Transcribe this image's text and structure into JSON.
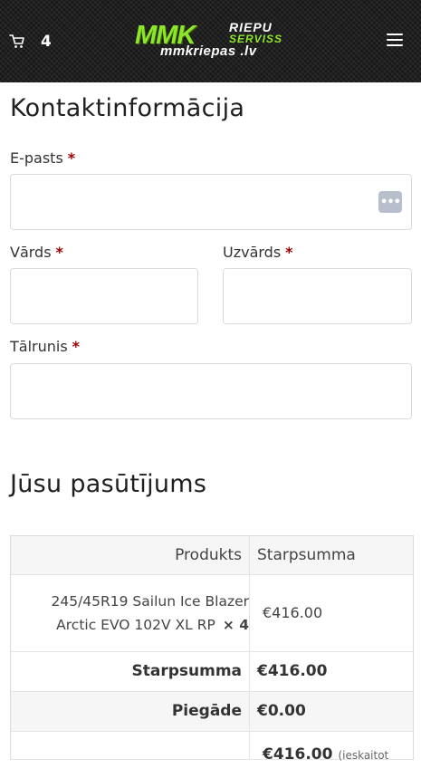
{
  "header": {
    "cart_count": "4",
    "logo": {
      "brand": "MMK",
      "line1": "RIEPU",
      "line2": "SERVISS",
      "url": "mmkriepas .lv"
    }
  },
  "contact": {
    "title": "Kontaktinformācija",
    "email_label": "E-pasts",
    "first_name_label": "Vārds",
    "last_name_label": "Uzvārds",
    "phone_label": "Tālrunis",
    "required_mark": "*",
    "email_value": "",
    "first_name_value": "",
    "last_name_value": "",
    "phone_value": ""
  },
  "order": {
    "title": "Jūsu pasūtījums",
    "col_product": "Produkts",
    "col_subtotal": "Starpsumma",
    "item": {
      "name": "245/45R19 Sailun Ice Blazer Arctic EVO 102V XL RP",
      "qty": "× 4",
      "price": "€416.00"
    },
    "subtotal_label": "Starpsumma",
    "subtotal_value": "€416.00",
    "shipping_label": "Piegāde",
    "shipping_value": "€0.00",
    "total_value": "€416.00",
    "total_note": "(ieskaitot"
  },
  "colors": {
    "accent_green": "#8ee62a",
    "header_bg": "#161616",
    "required_red": "#a50000"
  },
  "icons": {
    "cart": "cart-icon",
    "menu": "hamburger-menu-icon",
    "password_manager": "password-manager-icon"
  }
}
